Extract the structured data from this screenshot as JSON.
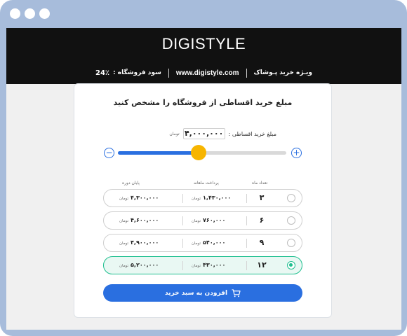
{
  "header": {
    "brand": "DIGISTYLE",
    "special_offer": "ویـژه خرید پـوشاک",
    "website": "www.digistyle.com",
    "store_profit_label": "سود فروشگاه :",
    "store_profit_value": "24٪"
  },
  "card": {
    "title": "مبلغ خرید اقساطی از فروشگاه را مشخص کنید",
    "amount_label": "مبلغ خرید اقساطی :",
    "amount_value": "۴,۰۰۰,۰۰۰",
    "amount_unit": "تومان"
  },
  "slider": {
    "level": 0.48,
    "minus": "−",
    "plus": "+",
    "fill_color": "#2a6fe0",
    "knob_color": "#f7b500"
  },
  "columns": {
    "months": "تعداد ماه",
    "monthly": "پرداخت ماهانه",
    "total": "پایان دوره"
  },
  "unit": "تومان",
  "options": [
    {
      "months": "۳",
      "monthly": "۱,۴۳۰,۰۰۰",
      "total": "۴,۳۰۰,۰۰۰",
      "selected": false
    },
    {
      "months": "۶",
      "monthly": "۷۶۰,۰۰۰",
      "total": "۴,۶۰۰,۰۰۰",
      "selected": false
    },
    {
      "months": "۹",
      "monthly": "۵۴۰,۰۰۰",
      "total": "۴,۹۰۰,۰۰۰",
      "selected": false
    },
    {
      "months": "۱۲",
      "monthly": "۴۳۰,۰۰۰",
      "total": "۵,۲۰۰,۰۰۰",
      "selected": true
    }
  ],
  "cart_button": {
    "label": "افزودن به سبد خرید",
    "icon": "cart-icon"
  },
  "colors": {
    "accent": "#2a6fe0",
    "selected": "#1fbf8f",
    "frame": "#a7bcdb"
  }
}
